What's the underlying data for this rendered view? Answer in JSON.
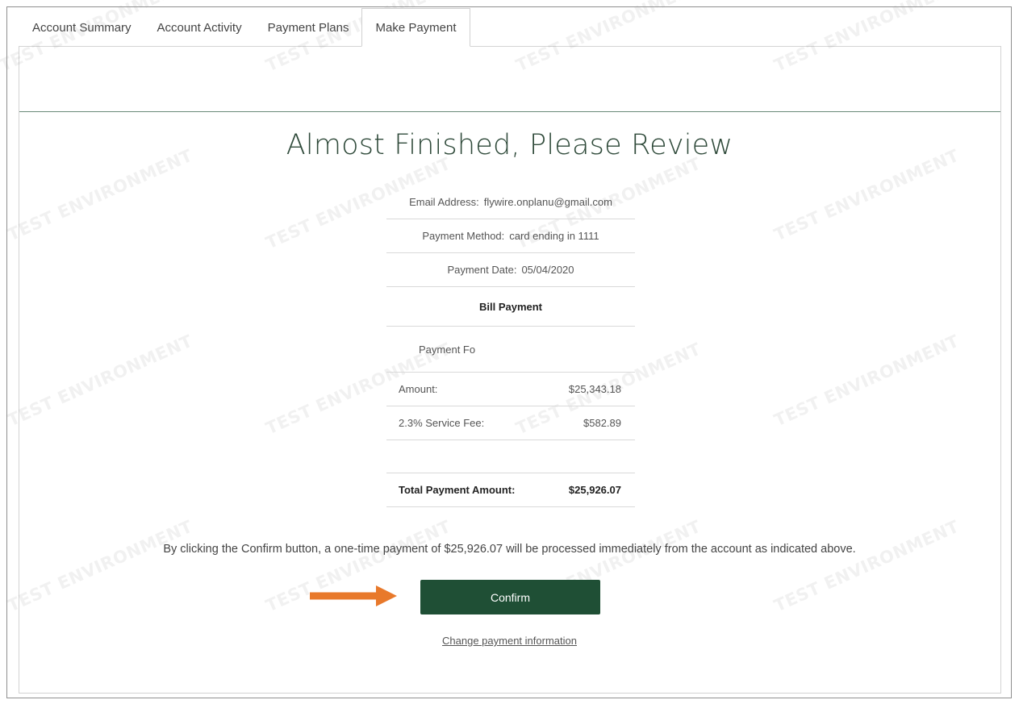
{
  "tabs": [
    {
      "label": "Account Summary"
    },
    {
      "label": "Account Activity"
    },
    {
      "label": "Payment Plans"
    },
    {
      "label": "Make Payment",
      "active": true
    }
  ],
  "watermark": "TEST ENVIRONMENT",
  "review": {
    "title": "Almost Finished, Please Review",
    "email_label": "Email Address:",
    "email_value": "flywire.onplanu@gmail.com",
    "method_label": "Payment Method:",
    "method_value": "card ending in 1111",
    "date_label": "Payment Date:",
    "date_value": "05/04/2020",
    "section_header": "Bill Payment",
    "payment_for_label": "Payment Fo",
    "amount_label": "Amount:",
    "amount_value": "$25,343.18",
    "fee_label": "2.3% Service Fee:",
    "fee_value": "$582.89",
    "total_label": "Total Payment Amount:",
    "total_value": "$25,926.07"
  },
  "notice": "By clicking the Confirm button, a one-time payment of $25,926.07 will be processed immediately from the account as indicated above.",
  "confirm_label": "Confirm",
  "change_link": "Change payment information",
  "colors": {
    "primary": "#1f4f35",
    "title": "#2f4a3a",
    "arrow": "#e8792b"
  },
  "icons": {
    "pointer": "arrow-right-icon"
  }
}
